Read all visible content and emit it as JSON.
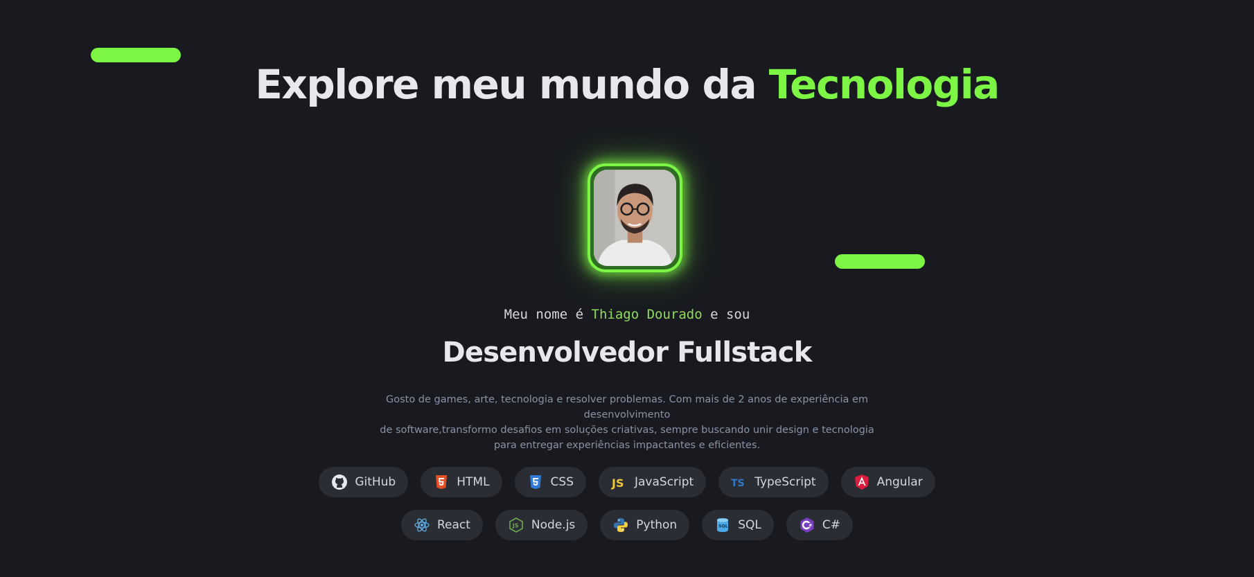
{
  "hero": {
    "title_main": "Explore meu mundo da ",
    "title_accent": "Tecnologia",
    "intro_prefix": "Meu nome é ",
    "intro_name": "Thiago Dourado",
    "intro_suffix": " e sou",
    "role": "Desenvolvedor Fullstack",
    "bio_lines": [
      "Gosto de games, arte, tecnologia e resolver problemas. Com mais de 2 anos de experiência em desenvolvimento",
      "de software,transformo desafios em soluções criativas, sempre buscando unir design e tecnologia",
      "para entregar experiências impactantes e eficientes."
    ]
  },
  "colors": {
    "background": "#181a1f",
    "accent": "#7cf544",
    "name_accent": "#8fdc5a",
    "chip_bg": "#2a2d34",
    "bio_text": "#8a93a6"
  },
  "skills_row1": [
    {
      "label": "GitHub",
      "icon": "github-icon"
    },
    {
      "label": "HTML",
      "icon": "html5-icon"
    },
    {
      "label": "CSS",
      "icon": "css3-icon"
    },
    {
      "label": "JavaScript",
      "icon": "javascript-icon"
    },
    {
      "label": "TypeScript",
      "icon": "typescript-icon"
    },
    {
      "label": "Angular",
      "icon": "angular-icon"
    }
  ],
  "skills_row2": [
    {
      "label": "React",
      "icon": "react-icon"
    },
    {
      "label": "Node.js",
      "icon": "nodejs-icon"
    },
    {
      "label": "Python",
      "icon": "python-icon"
    },
    {
      "label": "SQL",
      "icon": "sql-database-icon"
    },
    {
      "label": "C#",
      "icon": "csharp-icon"
    }
  ]
}
